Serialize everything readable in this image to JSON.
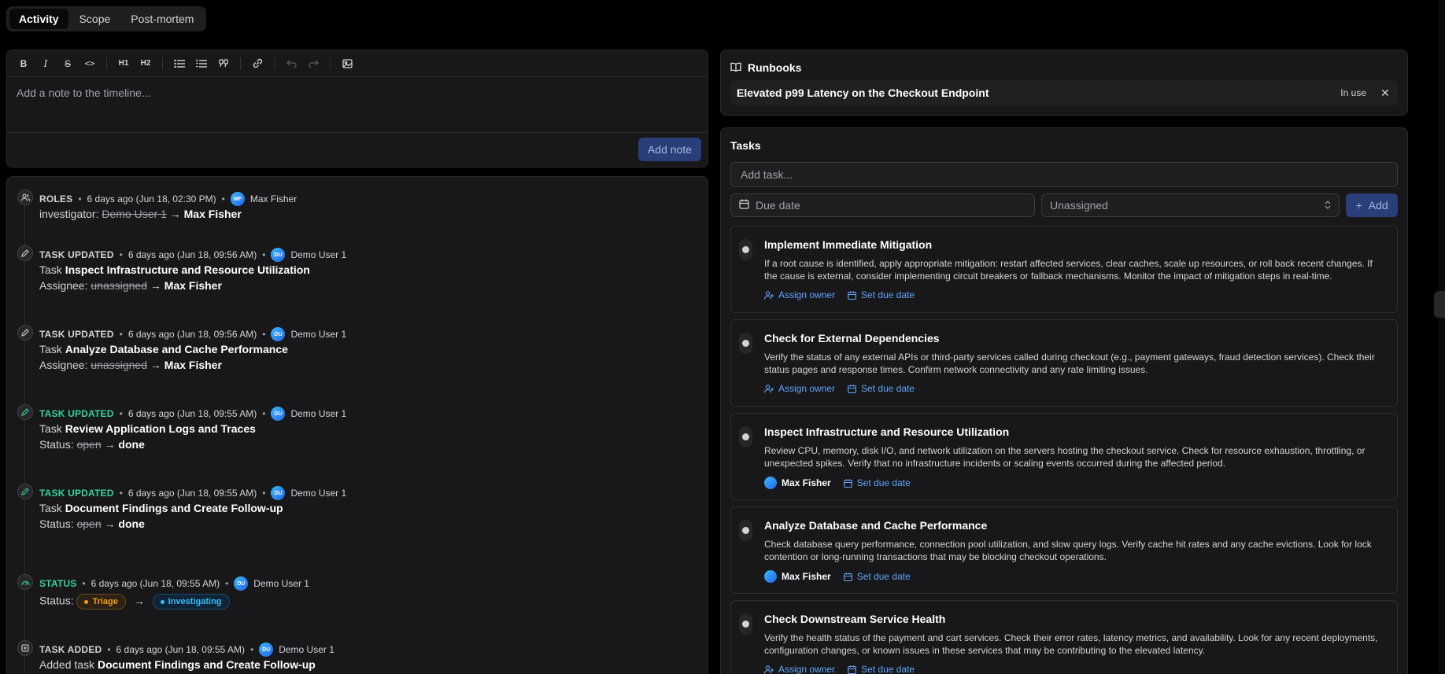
{
  "tabs": [
    {
      "label": "Activity",
      "active": true
    },
    {
      "label": "Scope",
      "active": false
    },
    {
      "label": "Post-mortem",
      "active": false
    }
  ],
  "editor": {
    "toolbar": {
      "bold": "B",
      "italic": "I",
      "strike": "S",
      "code": "<>",
      "h1": "H1",
      "h2": "H2"
    },
    "placeholder": "Add a note to the timeline...",
    "add_note_label": "Add note"
  },
  "timeline": [
    {
      "type": "ROLES",
      "time": "6 days ago (Jun 18, 02:30 PM)",
      "user": "Max Fisher",
      "initials": "MF",
      "line1_prefix": "investigator:",
      "old": "Demo User 1",
      "arrow": "→",
      "new": "Max Fisher",
      "icon": "users-icon"
    },
    {
      "type": "TASK UPDATED",
      "time": "6 days ago (Jun 18, 09:56 AM)",
      "user": "Demo User 1",
      "initials": "DU",
      "task_prefix": "Task",
      "task": "Inspect Infrastructure and Resource Utilization",
      "field": "Assignee:",
      "old": "unassigned",
      "arrow": "→",
      "new": "Max Fisher",
      "icon": "pencil-icon"
    },
    {
      "type": "TASK UPDATED",
      "time": "6 days ago (Jun 18, 09:56 AM)",
      "user": "Demo User 1",
      "initials": "DU",
      "task_prefix": "Task",
      "task": "Analyze Database and Cache Performance",
      "field": "Assignee:",
      "old": "unassigned",
      "arrow": "→",
      "new": "Max Fisher",
      "icon": "pencil-icon"
    },
    {
      "type": "TASK UPDATED",
      "time": "6 days ago (Jun 18, 09:55 AM)",
      "user": "Demo User 1",
      "initials": "DU",
      "task_prefix": "Task",
      "task": "Review Application Logs and Traces",
      "field": "Status:",
      "old": "open",
      "arrow": "→",
      "new": "done",
      "icon": "pencil-icon"
    },
    {
      "type": "TASK UPDATED",
      "time": "6 days ago (Jun 18, 09:55 AM)",
      "user": "Demo User 1",
      "initials": "DU",
      "task_prefix": "Task",
      "task": "Document Findings and Create Follow-up",
      "field": "Status:",
      "old": "open",
      "arrow": "→",
      "new": "done",
      "icon": "pencil-icon"
    },
    {
      "type": "STATUS",
      "time": "6 days ago (Jun 18, 09:55 AM)",
      "user": "Demo User 1",
      "initials": "DU",
      "field": "Status:",
      "old": "Triage",
      "arrow": "→",
      "new": "Investigating",
      "icon": "gauge-icon"
    },
    {
      "type": "TASK ADDED",
      "time": "6 days ago (Jun 18, 09:55 AM)",
      "user": "Demo User 1",
      "initials": "DU",
      "prefix": "Added task",
      "task": "Document Findings and Create Follow-up",
      "icon": "plus-square-icon"
    }
  ],
  "runbooks": {
    "title": "Runbooks",
    "item": {
      "name": "Elevated p99 Latency on the Checkout Endpoint",
      "badge": "In use",
      "close": "✕"
    }
  },
  "tasks": {
    "title": "Tasks",
    "add_placeholder": "Add task...",
    "due_label": "Due date",
    "assignee_value": "Unassigned",
    "add_label": "Add",
    "assign_owner_label": "Assign owner",
    "set_due_label": "Set due date",
    "items": [
      {
        "title": "Implement Immediate Mitigation",
        "desc": "If a root cause is identified, apply appropriate mitigation: restart affected services, clear caches, scale up resources, or roll back recent changes. If the cause is external, consider implementing circuit breakers or fallback mechanisms. Monitor the impact of mitigation steps in real-time.",
        "owner": ""
      },
      {
        "title": "Check for External Dependencies",
        "desc": "Verify the status of any external APIs or third-party services called during checkout (e.g., payment gateways, fraud detection services). Check their status pages and response times. Confirm network connectivity and any rate limiting issues.",
        "owner": ""
      },
      {
        "title": "Inspect Infrastructure and Resource Utilization",
        "desc": "Review CPU, memory, disk I/O, and network utilization on the servers hosting the checkout service. Check for resource exhaustion, throttling, or unexpected spikes. Verify that no infrastructure incidents or scaling events occurred during the affected period.",
        "owner": "Max Fisher"
      },
      {
        "title": "Analyze Database and Cache Performance",
        "desc": "Check database query performance, connection pool utilization, and slow query logs. Verify cache hit rates and any cache evictions. Look for lock contention or long-running transactions that may be blocking checkout operations.",
        "owner": "Max Fisher"
      },
      {
        "title": "Check Downstream Service Health",
        "desc": "Verify the health status of the payment and cart services. Check their error rates, latency metrics, and availability. Look for any recent deployments, configuration changes, or known issues in these services that may be contributing to the elevated latency.",
        "owner": ""
      }
    ]
  }
}
